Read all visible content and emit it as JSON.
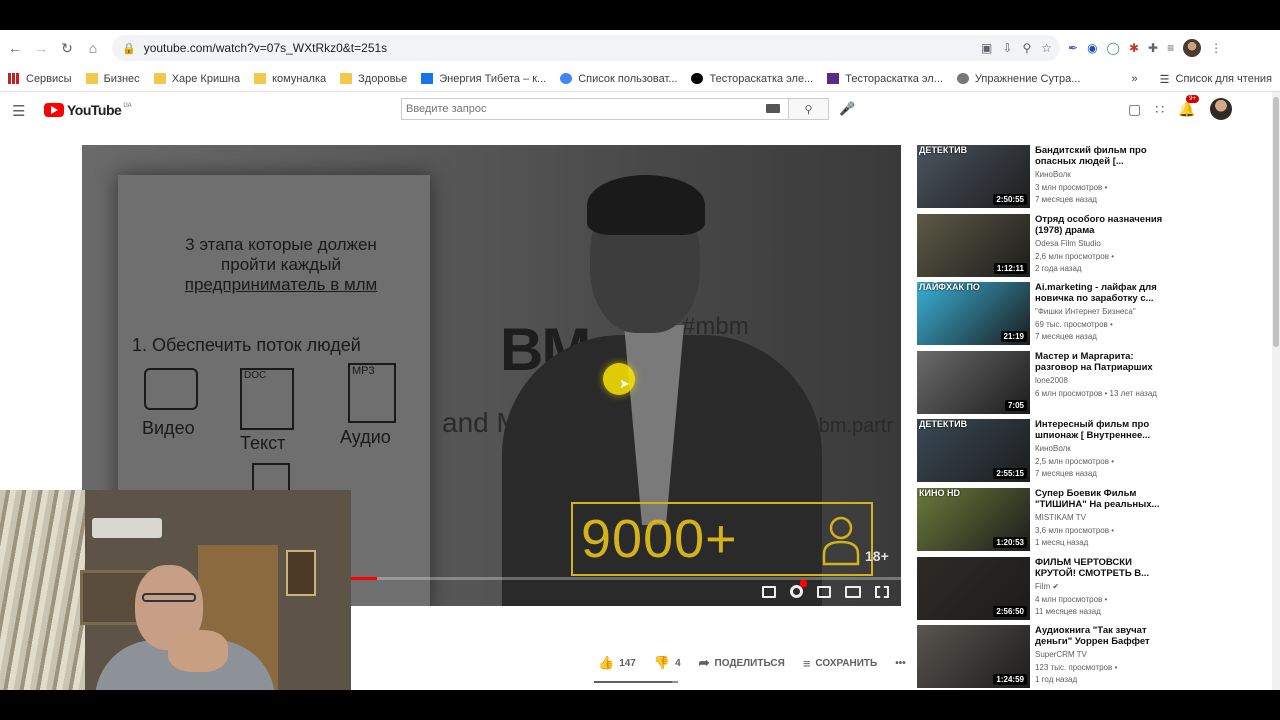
{
  "browser": {
    "url": "youtube.com/watch?v=07s_WXtRkz0&t=251s",
    "bookmarks": [
      "Сервисы",
      "Бизнес",
      "Харе Кришна",
      "комуналка",
      "Здоровье",
      "Энергия Тибета – к...",
      "Список пользоват...",
      "Тестораскатка эле...",
      "Тестораскатка эл...",
      "Упражнение Сутра..."
    ],
    "overflow": "»",
    "reading_list": "Список для чтения"
  },
  "youtube": {
    "logo_text": "YouTube",
    "country_code": "UA",
    "search_placeholder": "Введите запрос",
    "notification_count": "9+"
  },
  "video": {
    "slide": {
      "heading_line1": "3 этапа которые должен",
      "heading_line2": "пройти каждый",
      "heading_line3": "предприниматель в млм",
      "point": "1. Обеспечить поток людей",
      "label_video": "Видео",
      "label_text": "Текст",
      "label_audio": "Аудио",
      "doc_tag": "DOC",
      "mp3_tag": "MP3"
    },
    "wall_bm": "BM",
    "wall_hashtag": "#mbm",
    "wall_and": "and M",
    "wall_partner": "mbm.partr",
    "counter_text": "9000+",
    "age_rating": "18+",
    "progress_fraction": 0.36
  },
  "actions": {
    "likes": "147",
    "dislikes": "4",
    "share": "ПОДЕЛИТЬСЯ",
    "save": "СОХРАНИТЬ",
    "more": "•••"
  },
  "recommendations": [
    {
      "title": "Бандитский фильм про опасных людей [...",
      "channel": "КиноВолк",
      "views": "3 млн просмотров •",
      "age": "7 месяцев назад",
      "duration": "2:50:55",
      "overlay": "ДЕТЕКТИВ",
      "thumb_color": "#4b5560"
    },
    {
      "title": "Отряд особого назначения (1978) драма",
      "channel": "Odesa Film Studio",
      "views": "2,6 млн просмотров •",
      "age": "2 года назад",
      "duration": "1:12:11",
      "overlay": "",
      "thumb_color": "#5d5a45"
    },
    {
      "title": "Ai.marketing - лайфак для новичка по заработку с...",
      "channel": "\"Фишки Интернет Бизнеса\"",
      "views": "69 тыс. просмотров •",
      "age": "7 месяцев назад",
      "duration": "21:19",
      "overlay": "ЛАЙФХАК ПО",
      "thumb_color": "#39b0d6"
    },
    {
      "title": "Мастер и Маргарита: разговор на Патриарших",
      "channel": "lone2008",
      "views": "6 млн просмотров • 13 лет назад",
      "age": "",
      "duration": "7:05",
      "overlay": "",
      "thumb_color": "#6b6b6b"
    },
    {
      "title": "Интересный фильм про шпионаж [ Внутреннее...",
      "channel": "КиноВолк",
      "views": "2,5 млн просмотров •",
      "age": "7 месяцев назад",
      "duration": "2:55:15",
      "overlay": "ДЕТЕКТИВ",
      "thumb_color": "#3a4a55"
    },
    {
      "title": "Супер Боевик Фильм \"ТИШИНА\" На реальных...",
      "channel": "MISTIKAM TV",
      "views": "3,6 млн просмотров •",
      "age": "1 месяц назад",
      "duration": "1:20:53",
      "overlay": "КИНО HD",
      "thumb_color": "#6a7a3a"
    },
    {
      "title": "ФИЛЬМ ЧЕРТОВСКИ КРУТОЙ! СМОТРЕТЬ В...",
      "channel": "Film ✔",
      "views": "4 млн просмотров •",
      "age": "11 месяцев назад",
      "duration": "2:56:50",
      "overlay": "",
      "thumb_color": "#2e2a26"
    },
    {
      "title": "Аудиокнига \"Так звучат деньги\" Уоррен Баффет",
      "channel": "SuperCRM TV",
      "views": "123 тыс. просмотров •",
      "age": "1 год назад",
      "duration": "1:24:59",
      "overlay": "",
      "thumb_color": "#5a5550"
    }
  ],
  "colors": {
    "yt_red": "#ff0000",
    "counter_gold": "#d4b21b"
  }
}
